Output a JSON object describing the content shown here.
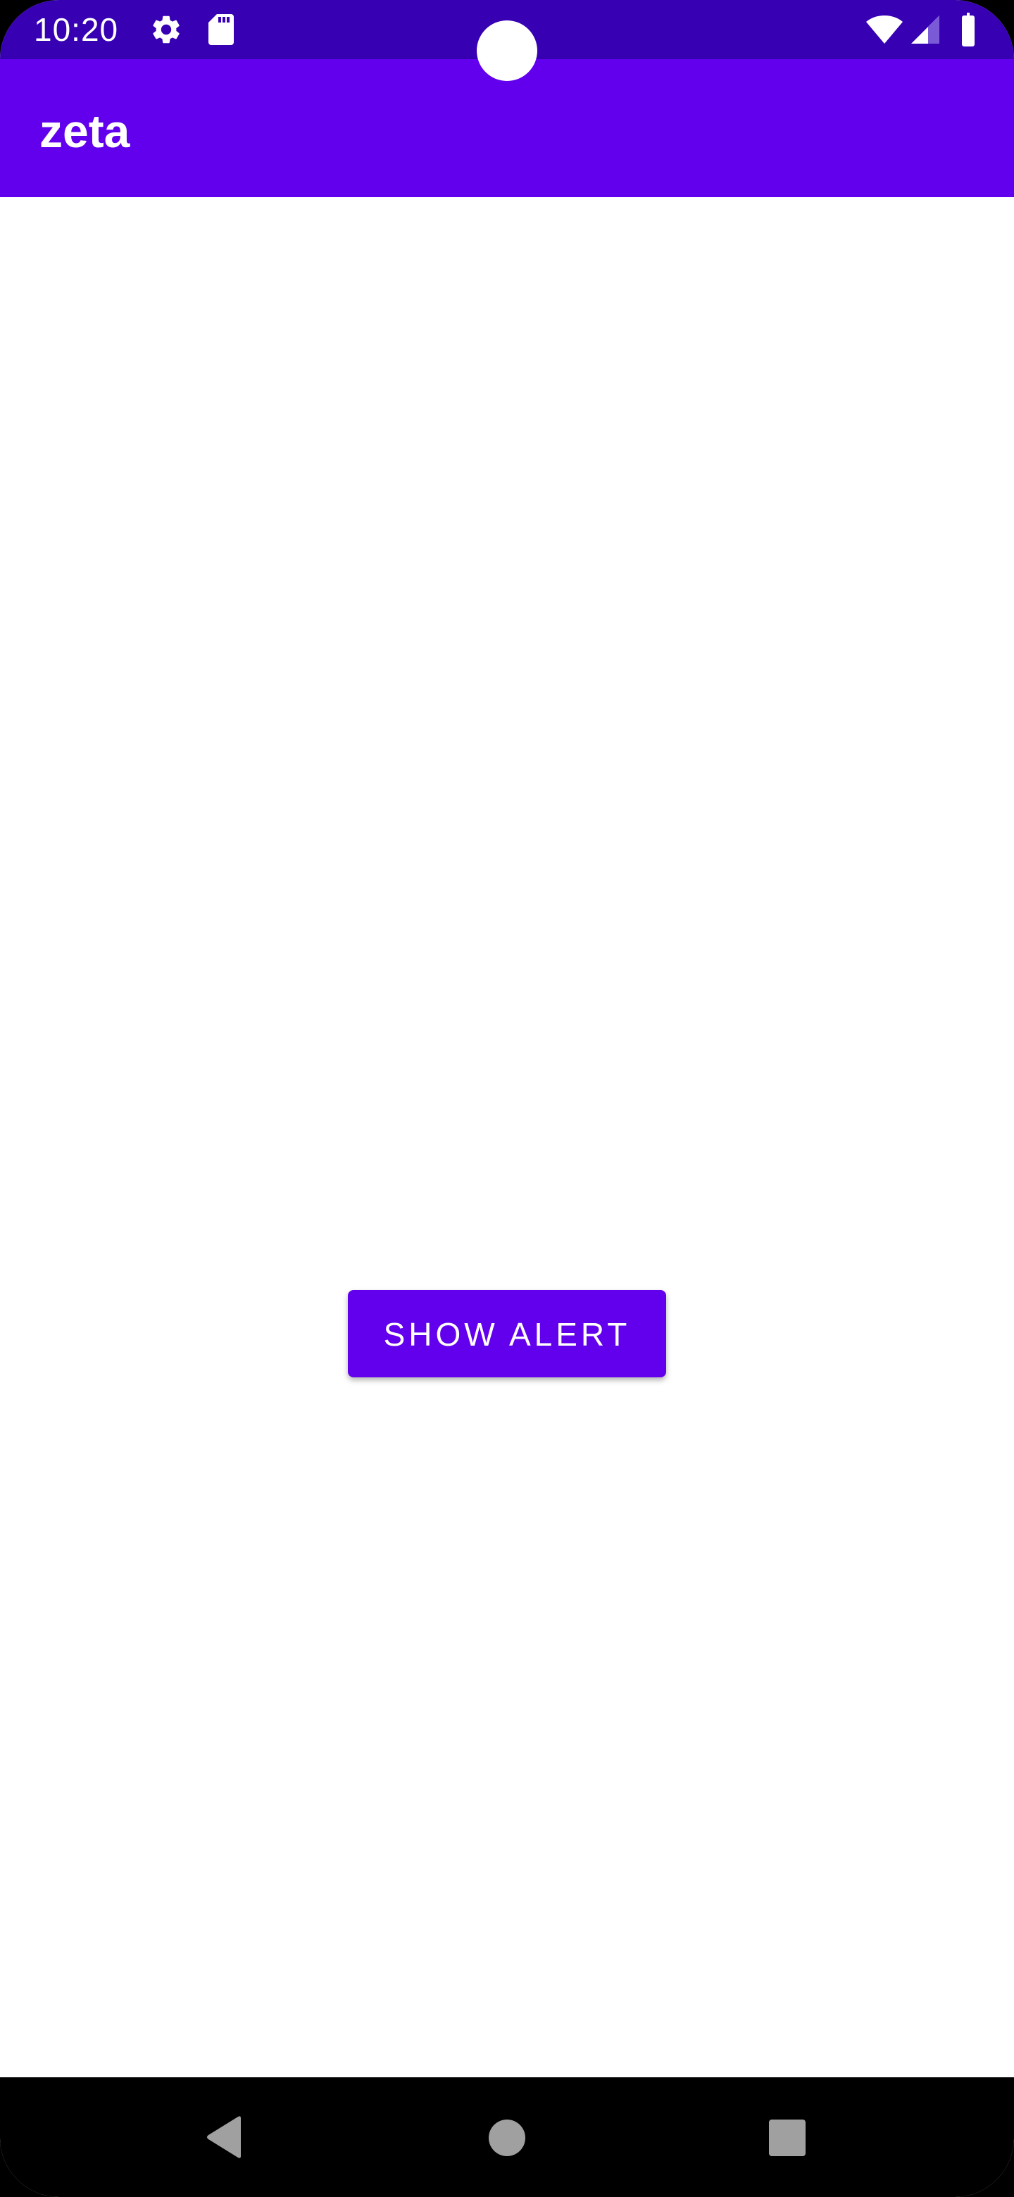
{
  "status_bar": {
    "time": "10:20",
    "icons": [
      "gear-icon",
      "sd-card-icon",
      "wifi-icon",
      "cellular-signal-icon",
      "battery-icon"
    ]
  },
  "app_bar": {
    "title": "zeta"
  },
  "main": {
    "show_alert_label": "SHOW ALERT"
  },
  "nav_bar": {
    "buttons": [
      "back-icon",
      "home-icon",
      "recents-icon"
    ]
  },
  "colors": {
    "status_bar": "#3700b3",
    "primary": "#6200ee",
    "background": "#ffffff",
    "nav_bar": "#000000"
  }
}
